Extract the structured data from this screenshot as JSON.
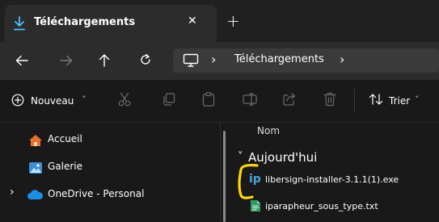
{
  "window": {
    "tab_title": "Téléchargements",
    "close_symbol": "✕",
    "new_tab_symbol": "+"
  },
  "nav": {
    "breadcrumb_sep_1": "›",
    "breadcrumb_item": "Téléchargements",
    "breadcrumb_sep_2": "›"
  },
  "toolbar": {
    "new_label": "Nouveau",
    "new_chevron": "˅",
    "sort_label": "Trier",
    "sort_chevron": "˅"
  },
  "sidebar": {
    "items": [
      {
        "label": "Accueil",
        "icon": "home-icon"
      },
      {
        "label": "Galerie",
        "icon": "gallery-icon"
      },
      {
        "label": "OneDrive - Personal",
        "icon": "cloud-icon",
        "expander": "›"
      }
    ]
  },
  "content": {
    "column_header": "Nom",
    "group_chevron": "˅",
    "group_label": "Aujourd'hui",
    "files": [
      {
        "name": "libersign-installer-3.1.1(1).exe",
        "icon": "exe-icon",
        "icon_text": "ip"
      },
      {
        "name": "iparapheur_sous_type.txt",
        "icon": "text-file-icon"
      }
    ]
  },
  "colors": {
    "accent_download": "#4cc2ff",
    "annotation_yellow": "#ffd800",
    "exe_icon": "#4aa3d8",
    "txt_icon": "#2e9a63"
  }
}
